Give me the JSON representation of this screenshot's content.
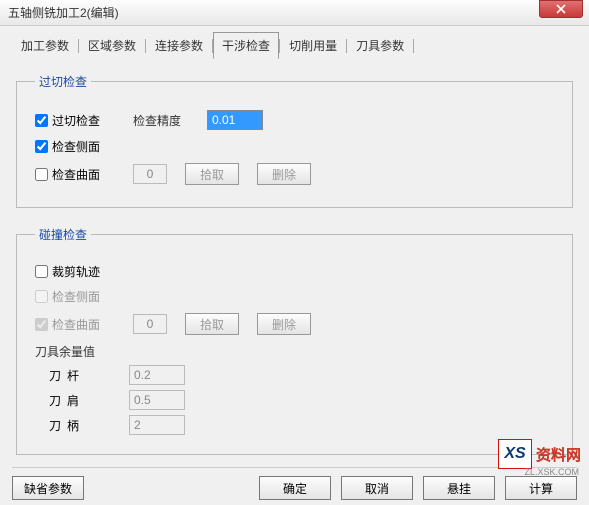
{
  "window": {
    "title": "五轴侧铣加工2(编辑)"
  },
  "tabs": [
    {
      "label": "加工参数"
    },
    {
      "label": "区域参数"
    },
    {
      "label": "连接参数"
    },
    {
      "label": "干涉检查",
      "active": true
    },
    {
      "label": "切削用量"
    },
    {
      "label": "刀具参数"
    }
  ],
  "group1": {
    "legend": "过切检查",
    "overcut_check_label": "过切检查",
    "precision_label": "检查精度",
    "precision_value": "0.01",
    "side_check_label": "检查侧面",
    "surface_check_label": "检查曲面",
    "surface_count": "0",
    "pick_label": "拾取",
    "delete_label": "删除"
  },
  "group2": {
    "legend": "碰撞检查",
    "trim_path_label": "裁剪轨迹",
    "side_check_label": "检查侧面",
    "surface_check_label": "检查曲面",
    "surface_count": "0",
    "pick_label": "拾取",
    "delete_label": "删除",
    "tool_margin_heading": "刀具余量值",
    "shank_label": "刀杆",
    "shank_value": "0.2",
    "shoulder_label": "刀肩",
    "shoulder_value": "0.5",
    "holder_label": "刀柄",
    "holder_value": "2"
  },
  "footer": {
    "default_label": "缺省参数",
    "ok_label": "确定",
    "cancel_label": "取消",
    "hang_label": "悬挂",
    "calc_label": "计算"
  },
  "watermark": {
    "badge": "XS",
    "text": "资料网",
    "sub": "ZL.XSK.COM"
  }
}
